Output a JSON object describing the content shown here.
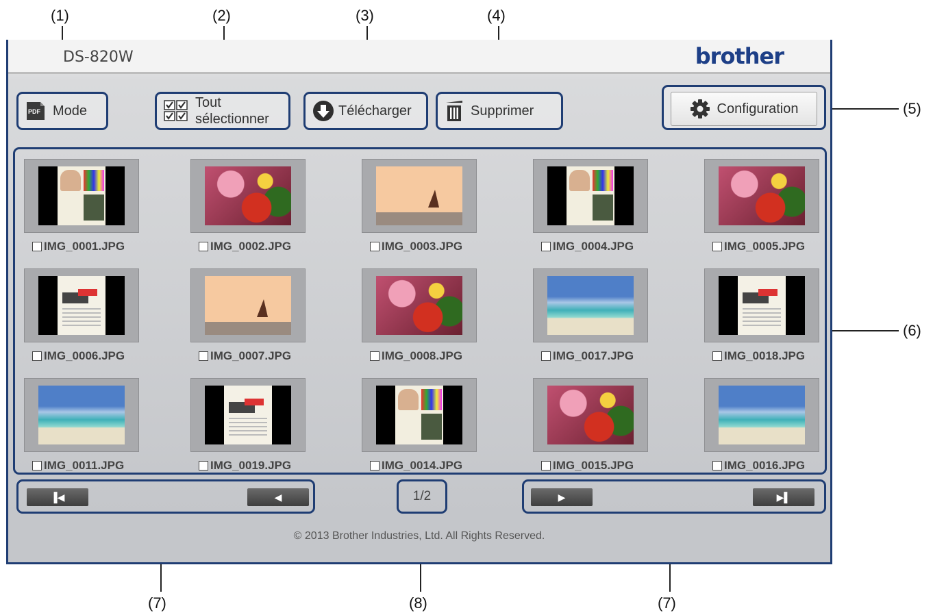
{
  "app": {
    "model": "DS-820W",
    "brand": "brother"
  },
  "callouts": {
    "c1": "(1)",
    "c2": "(2)",
    "c3": "(3)",
    "c4": "(4)",
    "c5": "(5)",
    "c6": "(6)",
    "c7a": "(7)",
    "c7b": "(7)",
    "c8": "(8)"
  },
  "toolbar": {
    "mode_label": "Mode",
    "select_all_line1": "Tout",
    "select_all_line2": "sélectionner",
    "download_label": "Télécharger",
    "delete_label": "Supprimer",
    "config_label": "Configuration"
  },
  "icons": {
    "mode": "pdf-icon",
    "select_all": "checkbox-grid-icon",
    "download": "download-circle-icon",
    "delete": "trash-icon",
    "config": "gear-icon"
  },
  "files": [
    {
      "name": "IMG_0001.JPG",
      "kind": "document-portrait"
    },
    {
      "name": "IMG_0002.JPG",
      "kind": "food"
    },
    {
      "name": "IMG_0003.JPG",
      "kind": "sailboat"
    },
    {
      "name": "IMG_0004.JPG",
      "kind": "document-portrait"
    },
    {
      "name": "IMG_0005.JPG",
      "kind": "food"
    },
    {
      "name": "IMG_0006.JPG",
      "kind": "document-printer"
    },
    {
      "name": "IMG_0007.JPG",
      "kind": "sailboat"
    },
    {
      "name": "IMG_0008.JPG",
      "kind": "food"
    },
    {
      "name": "IMG_0017.JPG",
      "kind": "beach"
    },
    {
      "name": "IMG_0018.JPG",
      "kind": "document-printer"
    },
    {
      "name": "IMG_0011.JPG",
      "kind": "beach"
    },
    {
      "name": "IMG_0019.JPG",
      "kind": "document-printer"
    },
    {
      "name": "IMG_0014.JPG",
      "kind": "document-portrait"
    },
    {
      "name": "IMG_0015.JPG",
      "kind": "food"
    },
    {
      "name": "IMG_0016.JPG",
      "kind": "beach"
    }
  ],
  "pagination": {
    "first": "▐◀",
    "prev": "◀",
    "next": "▶",
    "last": "▶▌",
    "page": "1/2"
  },
  "footer": "© 2013 Brother Industries, Ltd. All Rights Reserved.",
  "colors": {
    "highlight_border": "#1f3d73",
    "brand": "#1d3f87"
  }
}
